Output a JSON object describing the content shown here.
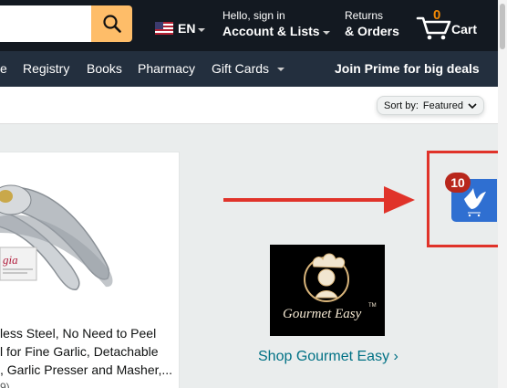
{
  "header": {
    "lang": "EN",
    "account_small": "Hello, sign in",
    "account_big": "Account & Lists",
    "returns_small": "Returns",
    "returns_big": "& Orders",
    "cart_count": "0",
    "cart_label": "Cart"
  },
  "subnav": {
    "items": [
      "e",
      "Registry",
      "Books",
      "Pharmacy",
      "Gift Cards"
    ],
    "prime": "Join Prime for big deals"
  },
  "sort": {
    "label": "Sort by:",
    "value": "Featured"
  },
  "product": {
    "title": "less Steel, No Need to Peel\nl for Fine Garlic, Detachable\n, Garlic Presser and Masher,...",
    "rating_fragment": "9)",
    "image_tag": "gia"
  },
  "extension": {
    "badge": "10"
  },
  "brand": {
    "logo_text": "Gourmet Easy",
    "trademark": "TM",
    "link": "Shop Gourmet Easy ›"
  },
  "colors": {
    "nav_dark": "#131921",
    "nav_sub": "#232f3e",
    "search_button": "#febd69",
    "cart_count": "#f08804",
    "link": "#007185",
    "annotation_red": "#e0332a",
    "extension_blue": "#2f6fd1",
    "badge_red": "#b8271c"
  }
}
